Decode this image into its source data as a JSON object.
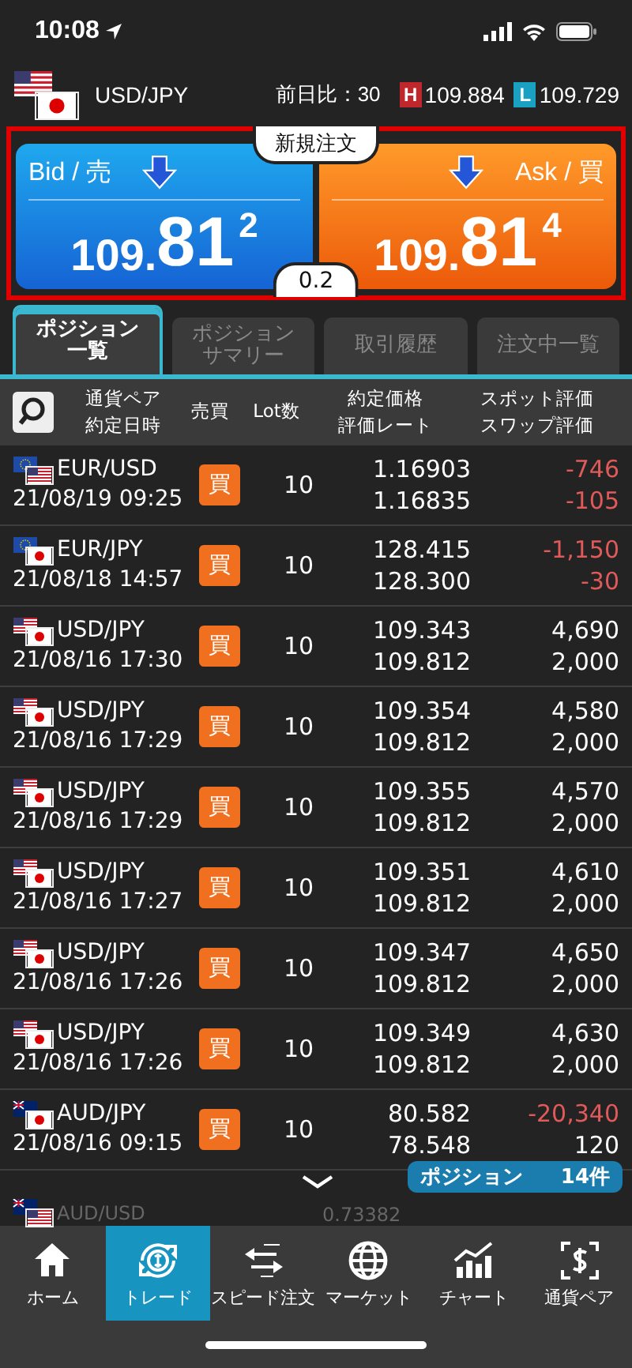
{
  "status_bar": {
    "time": "10:08"
  },
  "quote": {
    "flags": [
      {
        "kind": "us"
      },
      {
        "kind": "jp"
      }
    ],
    "pair": "USD/JPY",
    "change_label": "前日比：30",
    "high_label": "H",
    "high": "109.884",
    "low_label": "L",
    "low": "109.729"
  },
  "order_panel": {
    "title": "新規注文",
    "spread": "0.2",
    "bid": {
      "label": "Bid / 売",
      "price_head": "109.",
      "price_big": "81",
      "price_tail": "2"
    },
    "ask": {
      "label": "Ask / 買",
      "price_head": "109.",
      "price_big": "81",
      "price_tail": "4"
    }
  },
  "tabs": [
    {
      "label": "ポジション一覧",
      "selected": true
    },
    {
      "label": "ポジションサマリー",
      "selected": false
    },
    {
      "label": "取引履歴",
      "selected": false
    },
    {
      "label": "注文中一覧",
      "selected": false
    }
  ],
  "columns": [
    [
      "通貨ペア",
      "約定日時"
    ],
    [
      "売買"
    ],
    [
      "Lot数"
    ],
    [
      "約定価格",
      "評価レート"
    ],
    [
      "スポット評価",
      "スワップ評価"
    ]
  ],
  "rows": [
    {
      "flags": [
        {
          "kind": "eu"
        },
        {
          "kind": "us"
        }
      ],
      "pair": "EUR/USD",
      "date": "21/08/19 09:25",
      "side_label": "買",
      "lots": "10",
      "price": "1.16903",
      "rate": "1.16835",
      "spot": "-746",
      "spot_loss": true,
      "swap": "-105",
      "swap_loss": true
    },
    {
      "flags": [
        {
          "kind": "eu"
        },
        {
          "kind": "jp"
        }
      ],
      "pair": "EUR/JPY",
      "date": "21/08/18 14:57",
      "side_label": "買",
      "lots": "10",
      "price": "128.415",
      "rate": "128.300",
      "spot": "-1,150",
      "spot_loss": true,
      "swap": "-30",
      "swap_loss": true
    },
    {
      "flags": [
        {
          "kind": "us"
        },
        {
          "kind": "jp"
        }
      ],
      "pair": "USD/JPY",
      "date": "21/08/16 17:30",
      "side_label": "買",
      "lots": "10",
      "price": "109.343",
      "rate": "109.812",
      "spot": "4,690",
      "spot_loss": false,
      "swap": "2,000",
      "swap_loss": false
    },
    {
      "flags": [
        {
          "kind": "us"
        },
        {
          "kind": "jp"
        }
      ],
      "pair": "USD/JPY",
      "date": "21/08/16 17:29",
      "side_label": "買",
      "lots": "10",
      "price": "109.354",
      "rate": "109.812",
      "spot": "4,580",
      "spot_loss": false,
      "swap": "2,000",
      "swap_loss": false
    },
    {
      "flags": [
        {
          "kind": "us"
        },
        {
          "kind": "jp"
        }
      ],
      "pair": "USD/JPY",
      "date": "21/08/16 17:29",
      "side_label": "買",
      "lots": "10",
      "price": "109.355",
      "rate": "109.812",
      "spot": "4,570",
      "spot_loss": false,
      "swap": "2,000",
      "swap_loss": false
    },
    {
      "flags": [
        {
          "kind": "us"
        },
        {
          "kind": "jp"
        }
      ],
      "pair": "USD/JPY",
      "date": "21/08/16 17:27",
      "side_label": "買",
      "lots": "10",
      "price": "109.351",
      "rate": "109.812",
      "spot": "4,610",
      "spot_loss": false,
      "swap": "2,000",
      "swap_loss": false
    },
    {
      "flags": [
        {
          "kind": "us"
        },
        {
          "kind": "jp"
        }
      ],
      "pair": "USD/JPY",
      "date": "21/08/16 17:26",
      "side_label": "買",
      "lots": "10",
      "price": "109.347",
      "rate": "109.812",
      "spot": "4,650",
      "spot_loss": false,
      "swap": "2,000",
      "swap_loss": false
    },
    {
      "flags": [
        {
          "kind": "us"
        },
        {
          "kind": "jp"
        }
      ],
      "pair": "USD/JPY",
      "date": "21/08/16 17:26",
      "side_label": "買",
      "lots": "10",
      "price": "109.349",
      "rate": "109.812",
      "spot": "4,630",
      "spot_loss": false,
      "swap": "2,000",
      "swap_loss": false
    },
    {
      "flags": [
        {
          "kind": "au"
        },
        {
          "kind": "jp"
        }
      ],
      "pair": "AUD/JPY",
      "date": "21/08/16 09:15",
      "side_label": "買",
      "lots": "10",
      "price": "80.582",
      "rate": "78.548",
      "spot": "-20,340",
      "spot_loss": true,
      "swap": "120",
      "swap_loss": false
    }
  ],
  "partial_row": {
    "flags": [
      {
        "kind": "au"
      },
      {
        "kind": "us"
      }
    ],
    "pair": "AUD/USD",
    "price": "0.73382"
  },
  "position_count": {
    "label": "ポジション",
    "count": "14件"
  },
  "nav": [
    {
      "label": "ホーム",
      "selected": false
    },
    {
      "label": "トレード",
      "selected": true
    },
    {
      "label": "スピード注文",
      "selected": false
    },
    {
      "label": "マーケット",
      "selected": false
    },
    {
      "label": "チャート",
      "selected": false
    },
    {
      "label": "通貨ペア",
      "selected": false
    }
  ]
}
